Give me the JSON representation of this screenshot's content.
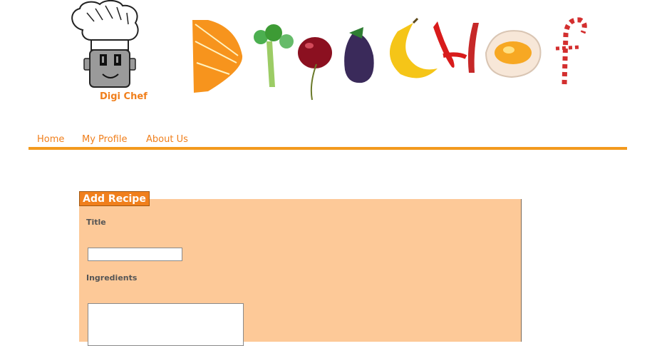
{
  "brand": {
    "logo_text": "Digi Chef"
  },
  "nav": {
    "items": [
      "Home",
      "My Profile",
      "About Us"
    ]
  },
  "form": {
    "title": "Add Recipe",
    "title_label": "Title",
    "title_value": "",
    "ingredients_label": "Ingredients",
    "ingredients_value": ""
  },
  "colors": {
    "accent": "#f07f1c",
    "panel": "#fdc998",
    "nav_line": "#f39a1e"
  }
}
